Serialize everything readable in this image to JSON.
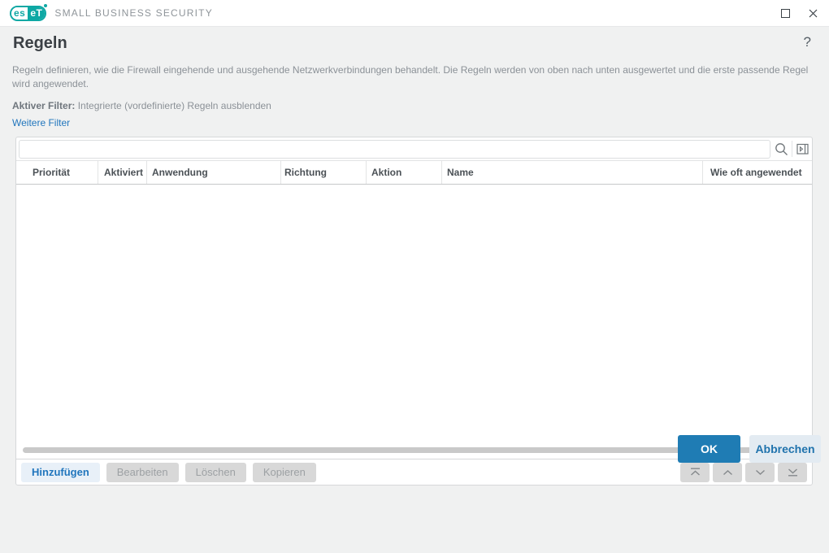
{
  "app": {
    "logo_left": "es",
    "logo_right": "eT",
    "brand": "SMALL BUSINESS SECURITY"
  },
  "page": {
    "title": "Regeln",
    "help_glyph": "?",
    "description": "Regeln definieren, wie die Firewall eingehende und ausgehende Netzwerkverbindungen behandelt. Die Regeln werden von oben nach unten ausgewertet und die erste passende Regel wird angewendet.",
    "active_filter_label": "Aktiver Filter:",
    "active_filter_value": "Integrierte (vordefinierte) Regeln ausblenden",
    "more_filters": "Weitere Filter"
  },
  "table": {
    "search_value": "",
    "columns": [
      "Priorität",
      "Aktiviert",
      "Anwendung",
      "Richtung",
      "Aktion",
      "Name",
      "Wie oft angewendet"
    ],
    "rows": []
  },
  "actions": {
    "add": "Hinzufügen",
    "edit": "Bearbeiten",
    "delete": "Löschen",
    "copy": "Kopieren"
  },
  "footer": {
    "ok": "OK",
    "cancel": "Abbrechen"
  },
  "colors": {
    "brand_teal": "#0ea8a4",
    "accent_blue": "#1f7cb4",
    "link_blue": "#2176bd",
    "disabled_gray": "#d8d8d8",
    "page_bg": "#f0f1f1"
  }
}
